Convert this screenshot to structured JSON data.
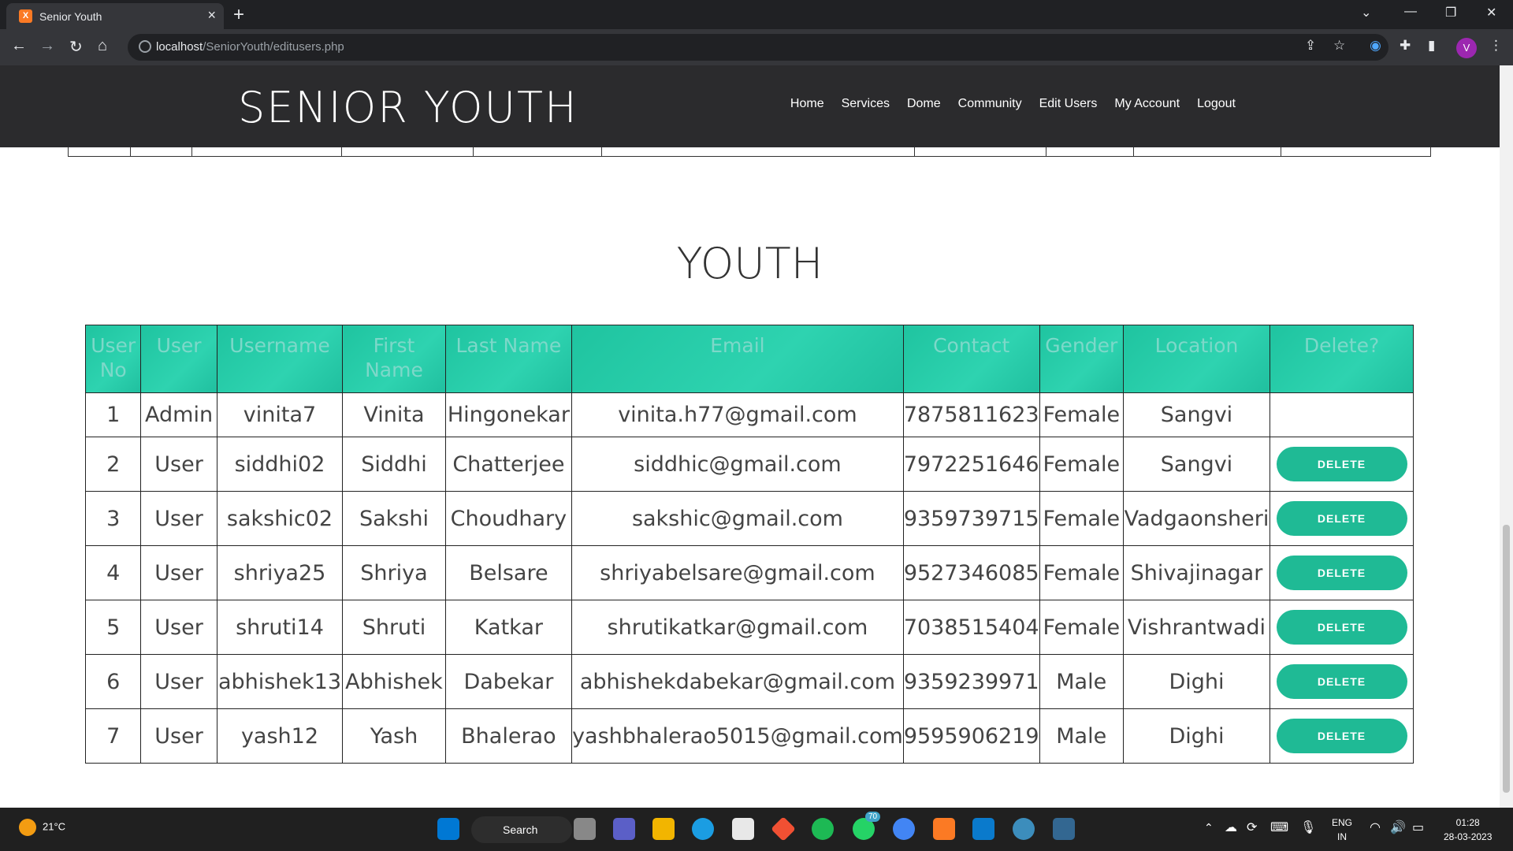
{
  "browser": {
    "tab_title": "Senior Youth",
    "favicon_glyph": "X",
    "url_host": "localhost",
    "url_path": "/SeniorYouth/editusers.php",
    "profile_initial": "V"
  },
  "site": {
    "logo": "SENIOR YOUTH",
    "nav": [
      "Home",
      "Services",
      "Dome",
      "Community",
      "Edit Users",
      "My Account",
      "Logout"
    ]
  },
  "section_title": "YOUTH",
  "table": {
    "headers": [
      "User No",
      "User",
      "Username",
      "First Name",
      "Last Name",
      "Email",
      "Contact",
      "Gender",
      "Location",
      "Delete?"
    ],
    "delete_label": "DELETE",
    "rows": [
      [
        "1",
        "Admin",
        "vinita7",
        "Vinita",
        "Hingonekar",
        "vinita.h77@gmail.com",
        "7875811623",
        "Female",
        "Sangvi"
      ],
      [
        "2",
        "User",
        "siddhi02",
        "Siddhi",
        "Chatterjee",
        "siddhic@gmail.com",
        "7972251646",
        "Female",
        "Sangvi"
      ],
      [
        "3",
        "User",
        "sakshic02",
        "Sakshi",
        "Choudhary",
        "sakshic@gmail.com",
        "9359739715",
        "Female",
        "Vadgaonsheri"
      ],
      [
        "4",
        "User",
        "shriya25",
        "Shriya",
        "Belsare",
        "shriyabelsare@gmail.com",
        "9527346085",
        "Female",
        "Shivajinagar"
      ],
      [
        "5",
        "User",
        "shruti14",
        "Shruti",
        "Katkar",
        "shrutikatkar@gmail.com",
        "7038515404",
        "Female",
        "Vishrantwadi"
      ],
      [
        "6",
        "User",
        "abhishek13",
        "Abhishek",
        "Dabekar",
        "abhishekdabekar@gmail.com",
        "9359239971",
        "Male",
        "Dighi"
      ],
      [
        "7",
        "User",
        "yash12",
        "Yash",
        "Bhalerao",
        "yashbhalerao5015@gmail.com",
        "9595906219",
        "Male",
        "Dighi"
      ]
    ]
  },
  "taskbar": {
    "weather": "21°C",
    "search_label": "Search",
    "whatsapp_badge": "70",
    "lang_top": "ENG",
    "lang_bottom": "IN",
    "time": "01:28",
    "date": "28-03-2023"
  },
  "colors": {
    "header_bg": "#2b2b2d",
    "accent": "#1fba95"
  }
}
